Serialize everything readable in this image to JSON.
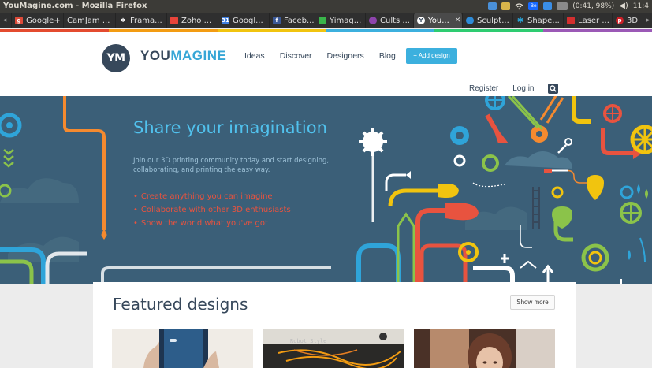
{
  "window": {
    "title": "YouMagine.com - Mozilla Firefox"
  },
  "system_tray": {
    "battery": "(0:41, 98%)",
    "clock": "11:4",
    "icons": [
      "dropbox-icon",
      "notebook-icon",
      "wifi-icon",
      "behance-icon",
      "mail-icon",
      "battery-icon",
      "volume-icon"
    ]
  },
  "tabs": [
    {
      "label": "Google+",
      "icon": "google-plus-icon",
      "color": "#dd4b39",
      "active": false
    },
    {
      "label": "CamJam ...",
      "icon": "camjam-icon",
      "color": "#2f2f2f",
      "active": false
    },
    {
      "label": "Frama...",
      "icon": "framasoft-icon",
      "color": "#ffffff",
      "active": false
    },
    {
      "label": "Zoho ...",
      "icon": "zoho-icon",
      "color": "#e8443a",
      "active": false
    },
    {
      "label": "Googl...",
      "icon": "google-calendar-icon",
      "color": "#3f7fdf",
      "active": false
    },
    {
      "label": "Faceb...",
      "icon": "facebook-icon",
      "color": "#3b5998",
      "active": false
    },
    {
      "label": "Yimag...",
      "icon": "yimaging-icon",
      "color": "#39b54a",
      "active": false
    },
    {
      "label": "Cults ...",
      "icon": "cults-icon",
      "color": "#8e44ad",
      "active": false
    },
    {
      "label": "You...",
      "icon": "youmagine-icon",
      "color": "#37485b",
      "active": true
    },
    {
      "label": "Sculpt...",
      "icon": "sculpteo-icon",
      "color": "#2e8bd8",
      "active": false
    },
    {
      "label": "Shape...",
      "icon": "shapeways-icon",
      "color": "#2aa2d4",
      "active": false
    },
    {
      "label": "Laser ...",
      "icon": "laser-icon",
      "color": "#d32f2f",
      "active": false
    },
    {
      "label": "3D",
      "icon": "pinterest-icon",
      "color": "#cb2027",
      "active": false
    }
  ],
  "rainbow_colors": [
    "#e44b2f",
    "#f39c12",
    "#f1c40f",
    "#3cb0de",
    "#2ecc71",
    "#9b59b6"
  ],
  "header": {
    "logo_badge": "YM",
    "logo_you": "YOU",
    "logo_magine": "MAGINE",
    "nav": [
      "Ideas",
      "Discover",
      "Designers",
      "Blog"
    ],
    "add_design": "+ Add design",
    "register": "Register",
    "login": "Log in"
  },
  "hero": {
    "title": "Share your imagination",
    "intro": "Join our 3D printing community today and start designing, collaborating, and printing the easy way.",
    "bullets": [
      "Create anything you can imagine",
      "Collaborate with other 3D enthusiasts",
      "Show the world what you've got"
    ]
  },
  "featured": {
    "title": "Featured designs",
    "show_more": "Show more",
    "card2_label": "Robot Style"
  },
  "colors": {
    "brand_dark": "#37485b",
    "brand_blue": "#36a6d6",
    "hero_bg": "#3b5f78",
    "hero_title": "#51c2ee",
    "accent_red": "#e8533f"
  }
}
